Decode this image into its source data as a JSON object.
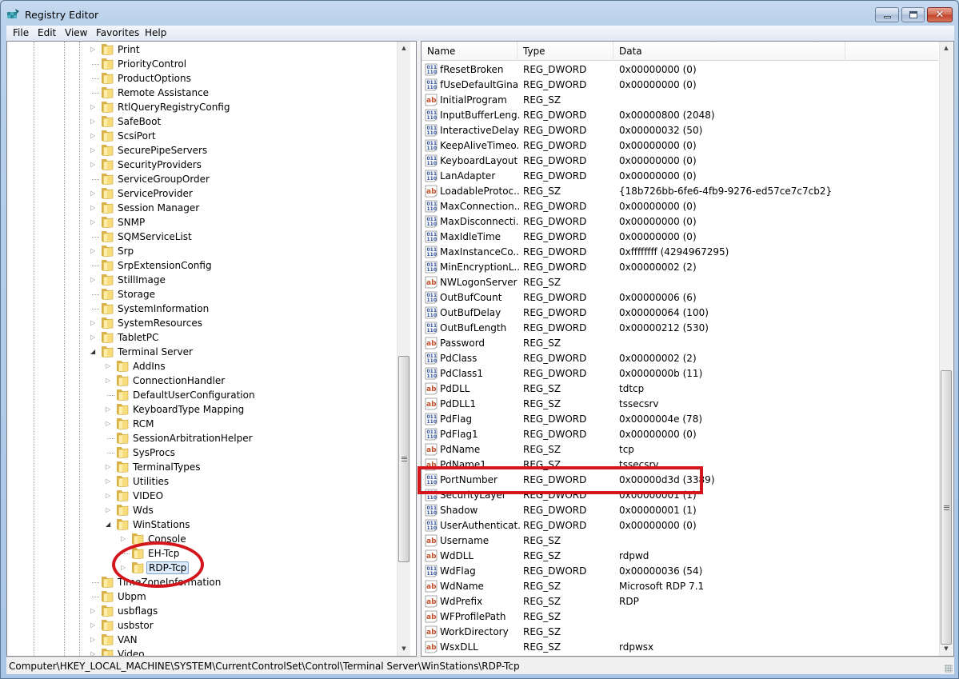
{
  "window": {
    "title": "Registry Editor",
    "icon": "registry-editor-icon",
    "controls": {
      "minimize": "minimize",
      "maximize": "maximize",
      "close": "✕"
    }
  },
  "menubar": [
    "File",
    "Edit",
    "View",
    "Favorites",
    "Help"
  ],
  "tree": {
    "items": [
      {
        "label": "Print",
        "level": 0,
        "expander": "collapsed"
      },
      {
        "label": "PriorityControl",
        "level": 0,
        "expander": "none"
      },
      {
        "label": "ProductOptions",
        "level": 0,
        "expander": "none"
      },
      {
        "label": "Remote Assistance",
        "level": 0,
        "expander": "none"
      },
      {
        "label": "RtlQueryRegistryConfig",
        "level": 0,
        "expander": "collapsed"
      },
      {
        "label": "SafeBoot",
        "level": 0,
        "expander": "collapsed"
      },
      {
        "label": "ScsiPort",
        "level": 0,
        "expander": "collapsed"
      },
      {
        "label": "SecurePipeServers",
        "level": 0,
        "expander": "collapsed"
      },
      {
        "label": "SecurityProviders",
        "level": 0,
        "expander": "collapsed"
      },
      {
        "label": "ServiceGroupOrder",
        "level": 0,
        "expander": "none"
      },
      {
        "label": "ServiceProvider",
        "level": 0,
        "expander": "collapsed"
      },
      {
        "label": "Session Manager",
        "level": 0,
        "expander": "collapsed"
      },
      {
        "label": "SNMP",
        "level": 0,
        "expander": "collapsed"
      },
      {
        "label": "SQMServiceList",
        "level": 0,
        "expander": "none"
      },
      {
        "label": "Srp",
        "level": 0,
        "expander": "collapsed"
      },
      {
        "label": "SrpExtensionConfig",
        "level": 0,
        "expander": "none"
      },
      {
        "label": "StillImage",
        "level": 0,
        "expander": "collapsed"
      },
      {
        "label": "Storage",
        "level": 0,
        "expander": "none"
      },
      {
        "label": "SystemInformation",
        "level": 0,
        "expander": "none"
      },
      {
        "label": "SystemResources",
        "level": 0,
        "expander": "collapsed"
      },
      {
        "label": "TabletPC",
        "level": 0,
        "expander": "collapsed"
      },
      {
        "label": "Terminal Server",
        "level": 0,
        "expander": "expanded"
      },
      {
        "label": "AddIns",
        "level": 1,
        "expander": "collapsed"
      },
      {
        "label": "ConnectionHandler",
        "level": 1,
        "expander": "collapsed"
      },
      {
        "label": "DefaultUserConfiguration",
        "level": 1,
        "expander": "none"
      },
      {
        "label": "KeyboardType Mapping",
        "level": 1,
        "expander": "collapsed"
      },
      {
        "label": "RCM",
        "level": 1,
        "expander": "collapsed"
      },
      {
        "label": "SessionArbitrationHelper",
        "level": 1,
        "expander": "none"
      },
      {
        "label": "SysProcs",
        "level": 1,
        "expander": "none"
      },
      {
        "label": "TerminalTypes",
        "level": 1,
        "expander": "collapsed"
      },
      {
        "label": "Utilities",
        "level": 1,
        "expander": "collapsed"
      },
      {
        "label": "VIDEO",
        "level": 1,
        "expander": "collapsed"
      },
      {
        "label": "Wds",
        "level": 1,
        "expander": "collapsed"
      },
      {
        "label": "WinStations",
        "level": 1,
        "expander": "expanded"
      },
      {
        "label": "Console",
        "level": 2,
        "expander": "collapsed"
      },
      {
        "label": "EH-Tcp",
        "level": 2,
        "expander": "none"
      },
      {
        "label": "RDP-Tcp",
        "level": 2,
        "expander": "collapsed",
        "selected": true
      },
      {
        "label": "TimeZoneInformation",
        "level": 0,
        "expander": "none"
      },
      {
        "label": "Ubpm",
        "level": 0,
        "expander": "none"
      },
      {
        "label": "usbflags",
        "level": 0,
        "expander": "collapsed"
      },
      {
        "label": "usbstor",
        "level": 0,
        "expander": "collapsed"
      },
      {
        "label": "VAN",
        "level": 0,
        "expander": "collapsed"
      },
      {
        "label": "Video",
        "level": 0,
        "expander": "collapsed"
      }
    ]
  },
  "list": {
    "columns": [
      "Name",
      "Type",
      "Data"
    ],
    "rows": [
      {
        "name": "fResetBroken",
        "type": "REG_DWORD",
        "data": "0x00000000 (0)"
      },
      {
        "name": "fUseDefaultGina",
        "type": "REG_DWORD",
        "data": "0x00000000 (0)"
      },
      {
        "name": "InitialProgram",
        "type": "REG_SZ",
        "data": ""
      },
      {
        "name": "InputBufferLeng...",
        "type": "REG_DWORD",
        "data": "0x00000800 (2048)"
      },
      {
        "name": "InteractiveDelay",
        "type": "REG_DWORD",
        "data": "0x00000032 (50)"
      },
      {
        "name": "KeepAliveTimeo...",
        "type": "REG_DWORD",
        "data": "0x00000000 (0)"
      },
      {
        "name": "KeyboardLayout",
        "type": "REG_DWORD",
        "data": "0x00000000 (0)"
      },
      {
        "name": "LanAdapter",
        "type": "REG_DWORD",
        "data": "0x00000000 (0)"
      },
      {
        "name": "LoadableProtoc...",
        "type": "REG_SZ",
        "data": "{18b726bb-6fe6-4fb9-9276-ed57ce7c7cb2}"
      },
      {
        "name": "MaxConnection...",
        "type": "REG_DWORD",
        "data": "0x00000000 (0)"
      },
      {
        "name": "MaxDisconnecti...",
        "type": "REG_DWORD",
        "data": "0x00000000 (0)"
      },
      {
        "name": "MaxIdleTime",
        "type": "REG_DWORD",
        "data": "0x00000000 (0)"
      },
      {
        "name": "MaxInstanceCo...",
        "type": "REG_DWORD",
        "data": "0xffffffff (4294967295)"
      },
      {
        "name": "MinEncryptionL...",
        "type": "REG_DWORD",
        "data": "0x00000002 (2)"
      },
      {
        "name": "NWLogonServer",
        "type": "REG_SZ",
        "data": ""
      },
      {
        "name": "OutBufCount",
        "type": "REG_DWORD",
        "data": "0x00000006 (6)"
      },
      {
        "name": "OutBufDelay",
        "type": "REG_DWORD",
        "data": "0x00000064 (100)"
      },
      {
        "name": "OutBufLength",
        "type": "REG_DWORD",
        "data": "0x00000212 (530)"
      },
      {
        "name": "Password",
        "type": "REG_SZ",
        "data": ""
      },
      {
        "name": "PdClass",
        "type": "REG_DWORD",
        "data": "0x00000002 (2)"
      },
      {
        "name": "PdClass1",
        "type": "REG_DWORD",
        "data": "0x0000000b (11)"
      },
      {
        "name": "PdDLL",
        "type": "REG_SZ",
        "data": "tdtcp"
      },
      {
        "name": "PdDLL1",
        "type": "REG_SZ",
        "data": "tssecsrv"
      },
      {
        "name": "PdFlag",
        "type": "REG_DWORD",
        "data": "0x0000004e (78)"
      },
      {
        "name": "PdFlag1",
        "type": "REG_DWORD",
        "data": "0x00000000 (0)"
      },
      {
        "name": "PdName",
        "type": "REG_SZ",
        "data": "tcp"
      },
      {
        "name": "PdName1",
        "type": "REG_SZ",
        "data": "tssecsrv"
      },
      {
        "name": "PortNumber",
        "type": "REG_DWORD",
        "data": "0x00000d3d (3389)",
        "highlighted": true
      },
      {
        "name": "SecurityLayer",
        "type": "REG_DWORD",
        "data": "0x00000001 (1)"
      },
      {
        "name": "Shadow",
        "type": "REG_DWORD",
        "data": "0x00000001 (1)"
      },
      {
        "name": "UserAuthenticat...",
        "type": "REG_DWORD",
        "data": "0x00000000 (0)"
      },
      {
        "name": "Username",
        "type": "REG_SZ",
        "data": ""
      },
      {
        "name": "WdDLL",
        "type": "REG_SZ",
        "data": "rdpwd"
      },
      {
        "name": "WdFlag",
        "type": "REG_DWORD",
        "data": "0x00000036 (54)"
      },
      {
        "name": "WdName",
        "type": "REG_SZ",
        "data": "Microsoft RDP 7.1"
      },
      {
        "name": "WdPrefix",
        "type": "REG_SZ",
        "data": "RDP"
      },
      {
        "name": "WFProfilePath",
        "type": "REG_SZ",
        "data": ""
      },
      {
        "name": "WorkDirectory",
        "type": "REG_SZ",
        "data": ""
      },
      {
        "name": "WsxDLL",
        "type": "REG_SZ",
        "data": "rdpwsx"
      }
    ]
  },
  "statusbar": {
    "path": "Computer\\HKEY_LOCAL_MACHINE\\SYSTEM\\CurrentControlSet\\Control\\Terminal Server\\WinStations\\RDP-Tcp"
  },
  "annotations": {
    "color": "#d4161c",
    "highlight_rect_target": "PortNumber",
    "highlight_ellipse_target": "RDP-Tcp"
  }
}
